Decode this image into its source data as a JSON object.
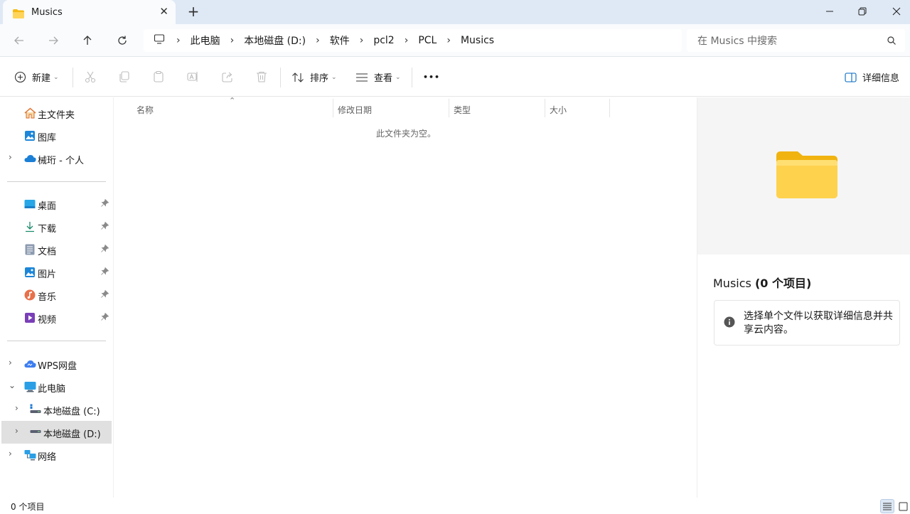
{
  "tab": {
    "title": "Musics",
    "close": "✕",
    "new_tab": "+"
  },
  "window_controls": {
    "minimize": "—",
    "maximize": "❐",
    "close": "✕"
  },
  "breadcrumb": [
    "此电脑",
    "本地磁盘 (D:)",
    "软件",
    "pcl2",
    "PCL",
    "Musics"
  ],
  "search": {
    "placeholder": "在 Musics 中搜索"
  },
  "toolbar": {
    "new_label": "新建",
    "sort_label": "排序",
    "view_label": "查看",
    "more_label": "•••",
    "details_label": "详细信息"
  },
  "nav": {
    "home": "主文件夹",
    "gallery": "图库",
    "onedrive": "械珩 - 个人",
    "desktop": "桌面",
    "downloads": "下载",
    "documents": "文档",
    "pictures": "图片",
    "music": "音乐",
    "videos": "视频",
    "wps": "WPS网盘",
    "this_pc": "此电脑",
    "drive_c": "本地磁盘 (C:)",
    "drive_d": "本地磁盘 (D:)",
    "network": "网络"
  },
  "columns": {
    "name": "名称",
    "modified": "修改日期",
    "type": "类型",
    "size": "大小"
  },
  "empty_message": "此文件夹为空。",
  "details": {
    "title_name": "Musics",
    "title_count": "(0 个项目)",
    "info": "选择单个文件以获取详细信息并共享云内容。"
  },
  "status": {
    "items": "0 个项目"
  },
  "colors": {
    "accent": "#0067c0",
    "titlebar": "#dfe9f5",
    "folder": "#f8c830",
    "selected": "#e0e0e0"
  }
}
